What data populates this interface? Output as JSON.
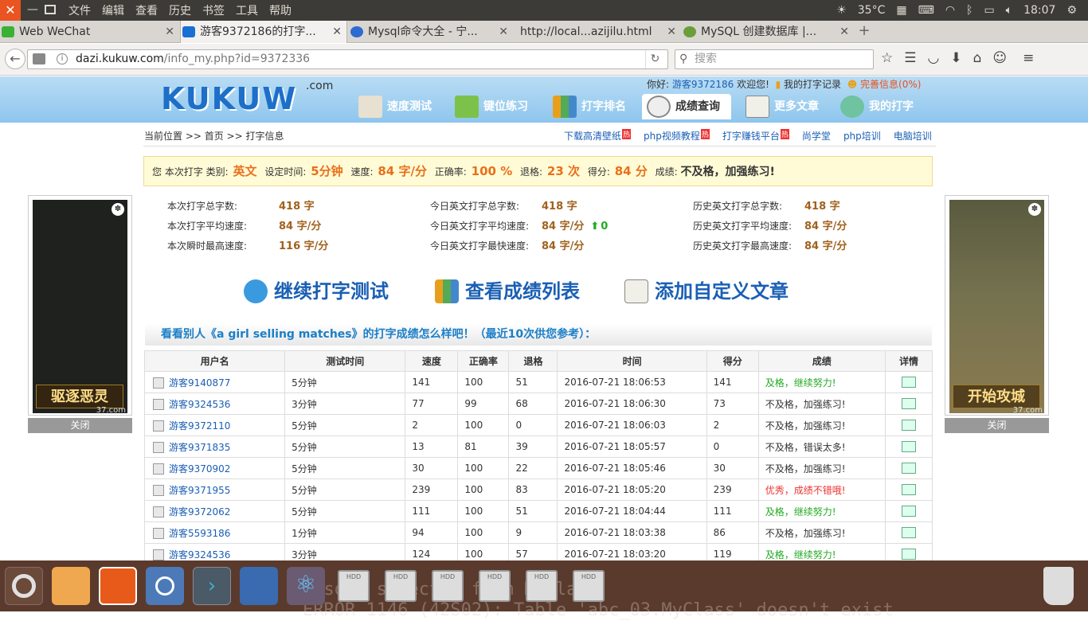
{
  "system": {
    "menus": [
      "文件",
      "编辑",
      "查看",
      "历史",
      "书签",
      "工具",
      "帮助"
    ],
    "temperature": "35°C",
    "time": "18:07"
  },
  "tabs": [
    {
      "label": "Web WeChat",
      "color": "#3cb034"
    },
    {
      "label": "游客9372186的打字...",
      "color": "#1a6fd4",
      "active": true
    },
    {
      "label": "Mysql命令大全 - 宁...",
      "color": "#2d6bd0"
    },
    {
      "label": "http://local...azijilu.html",
      "color": ""
    },
    {
      "label": "MySQL 创建数据库 |...",
      "color": "#6a9e3a"
    }
  ],
  "nav": {
    "url_host": "dazi.kukuw.com",
    "url_path": "/info_my.php?id=9372336",
    "url_prefix": "",
    "search_placeholder": "搜索"
  },
  "site": {
    "logo": "KUKUW",
    "logo_suffix": ".com",
    "welcome_prefix": "你好:",
    "username": "游客9372186",
    "welcome_suffix": "欢迎您!",
    "my_record": "我的打字记录",
    "perfect_info": "完善信息(0%)",
    "nav_items": [
      "速度测试",
      "键位练习",
      "打字排名",
      "成绩查询",
      "更多文章",
      "我的打字"
    ],
    "breadcrumb": "当前位置 >> 首页 >> 打字信息",
    "top_links": [
      "下载高清壁纸",
      "php视频教程",
      "打字赚钱平台",
      "尚学堂",
      "php培训",
      "电脑培训"
    ],
    "hot_label": "热"
  },
  "result": {
    "prefix": "您 本次打字 类别:",
    "category": "英文",
    "time_label": "设定时间:",
    "time": "5分钟",
    "speed_label": "速度:",
    "speed": "84 字/分",
    "accuracy_label": "正确率:",
    "accuracy": "100 %",
    "backspace_label": "退格:",
    "backspace": "23 次",
    "score_label": "得分:",
    "score": "84 分",
    "grade_label": "成绩:",
    "grade": "不及格，加强练习!"
  },
  "stats": [
    [
      {
        "label": "本次打字总字数:",
        "value": "418 字"
      },
      {
        "label": "本次打字平均速度:",
        "value": "84 字/分"
      },
      {
        "label": "本次瞬时最高速度:",
        "value": "116 字/分"
      }
    ],
    [
      {
        "label": "今日英文打字总字数:",
        "value": "418 字"
      },
      {
        "label": "今日英文打字平均速度:",
        "value": "84 字/分",
        "delta": "0"
      },
      {
        "label": "今日英文打字最快速度:",
        "value": "84 字/分"
      }
    ],
    [
      {
        "label": "历史英文打字总字数:",
        "value": "418 字"
      },
      {
        "label": "历史英文打字平均速度:",
        "value": "84 字/分"
      },
      {
        "label": "历史英文打字最高速度:",
        "value": "84 字/分"
      }
    ]
  ],
  "big_buttons": [
    "继续打字测试",
    "查看成绩列表",
    "添加自定义文章"
  ],
  "others_heading": "看看别人《a girl selling matches》的打字成绩怎么样吧！（最近10次供您参考）：",
  "table": {
    "headers": [
      "用户名",
      "测试时间",
      "速度",
      "正确率",
      "退格",
      "时间",
      "得分",
      "成绩",
      "详情"
    ],
    "rows": [
      [
        "游客9140877",
        "5分钟",
        "141",
        "100",
        "51",
        "2016-07-21 18:06:53",
        "141",
        "及格，继续努力!",
        "good"
      ],
      [
        "游客9324536",
        "3分钟",
        "77",
        "99",
        "68",
        "2016-07-21 18:06:30",
        "73",
        "不及格，加强练习!",
        "bad"
      ],
      [
        "游客9372110",
        "5分钟",
        "2",
        "100",
        "0",
        "2016-07-21 18:06:03",
        "2",
        "不及格，加强练习!",
        "bad"
      ],
      [
        "游客9371835",
        "5分钟",
        "13",
        "81",
        "39",
        "2016-07-21 18:05:57",
        "0",
        "不及格，错误太多!",
        "bad"
      ],
      [
        "游客9370902",
        "5分钟",
        "30",
        "100",
        "22",
        "2016-07-21 18:05:46",
        "30",
        "不及格，加强练习!",
        "bad"
      ],
      [
        "游客9371955",
        "5分钟",
        "239",
        "100",
        "83",
        "2016-07-21 18:05:20",
        "239",
        "优秀，成绩不错哦!",
        "great"
      ],
      [
        "游客9372062",
        "5分钟",
        "111",
        "100",
        "51",
        "2016-07-21 18:04:44",
        "111",
        "及格，继续努力!",
        "good"
      ],
      [
        "游客5593186",
        "1分钟",
        "94",
        "100",
        "9",
        "2016-07-21 18:03:38",
        "86",
        "不及格，加强练习!",
        "bad"
      ],
      [
        "游客9324536",
        "3分钟",
        "124",
        "100",
        "57",
        "2016-07-21 18:03:20",
        "119",
        "及格，继续努力!",
        "good"
      ]
    ]
  },
  "ads": {
    "left_title": "驱逐恶灵",
    "right_title": "开始攻城",
    "ad_mark": "37.com",
    "close": "关闭"
  },
  "dock": {
    "terminal_bg": "mysql> select * from MyClass;\nERROR 1146 (42S02): Table 'abc_03.MyClass' doesn't exist",
    "hdd_label": "HDD"
  }
}
